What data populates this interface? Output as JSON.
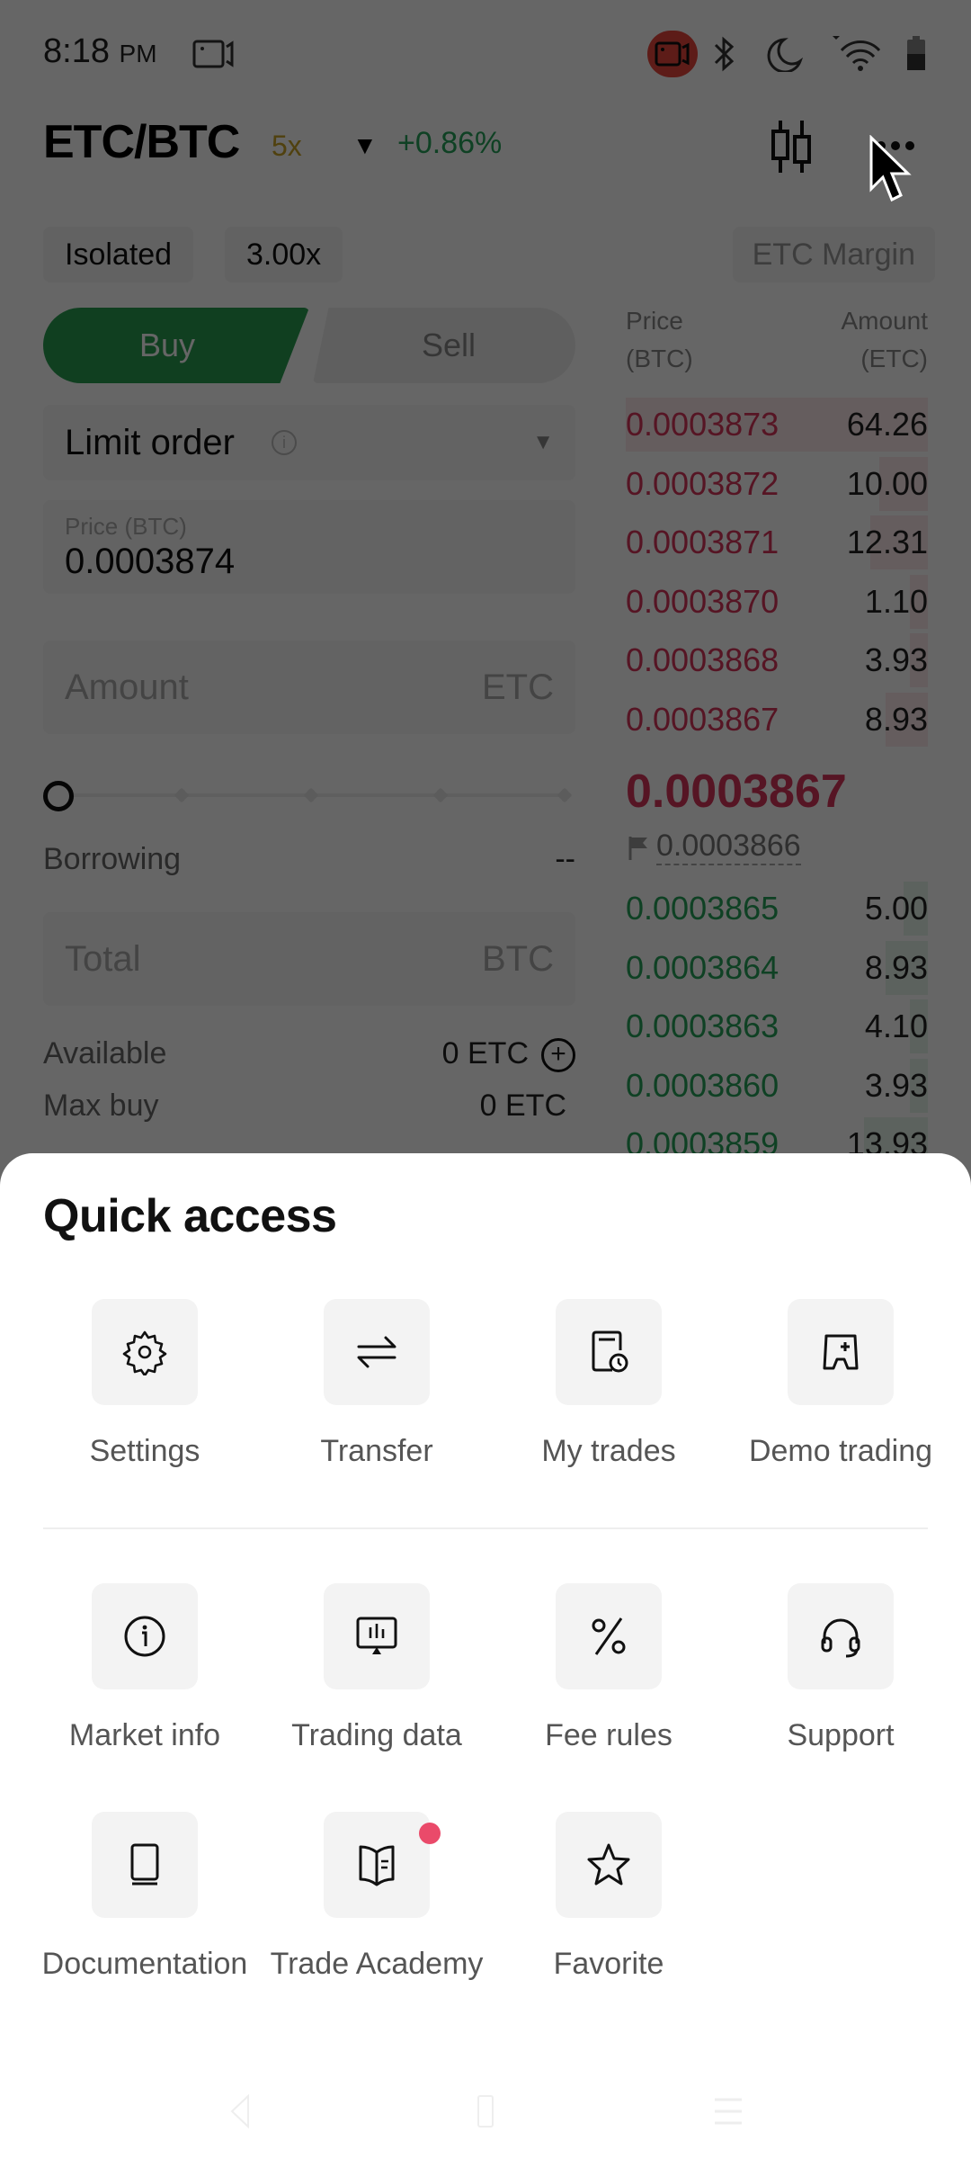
{
  "status_bar": {
    "time": "8:18",
    "ampm": "PM",
    "icons": [
      "screen-record-icon",
      "recording-active-icon",
      "bluetooth-icon",
      "do-not-disturb-icon",
      "wifi-icon",
      "battery-icon"
    ]
  },
  "header": {
    "pair": "ETC/BTC",
    "leverage_badge": "5x",
    "change": "+0.86%",
    "change_color": "#27a35a"
  },
  "margin": {
    "mode": "Isolated",
    "leverage": "3.00x",
    "margin_type": "ETC Margin"
  },
  "order_form": {
    "buy_label": "Buy",
    "sell_label": "Sell",
    "order_type": "Limit order",
    "price_label": "Price (BTC)",
    "price_value": "0.0003874",
    "amount_placeholder": "Amount",
    "amount_unit": "ETC",
    "slider_value_percent": 0,
    "borrowing_label": "Borrowing",
    "borrowing_value": "--",
    "total_placeholder": "Total",
    "total_unit": "BTC",
    "available_label": "Available",
    "available_value": "0 ETC",
    "max_buy_label": "Max buy",
    "max_buy_value": "0 ETC"
  },
  "order_book": {
    "price_header_1": "Price",
    "price_header_2": "(BTC)",
    "amount_header_1": "Amount",
    "amount_header_2": "(ETC)",
    "asks": [
      {
        "price": "0.0003873",
        "amount": "64.26",
        "depth": 1.0
      },
      {
        "price": "0.0003872",
        "amount": "10.00",
        "depth": 0.16
      },
      {
        "price": "0.0003871",
        "amount": "12.31",
        "depth": 0.19
      },
      {
        "price": "0.0003870",
        "amount": "1.10",
        "depth": 0.06
      },
      {
        "price": "0.0003868",
        "amount": "3.93",
        "depth": 0.06
      },
      {
        "price": "0.0003867",
        "amount": "8.93",
        "depth": 0.14
      }
    ],
    "last_price": "0.0003867",
    "mark_price": "0.0003866",
    "bids": [
      {
        "price": "0.0003865",
        "amount": "5.00",
        "depth": 0.08
      },
      {
        "price": "0.0003864",
        "amount": "8.93",
        "depth": 0.14
      },
      {
        "price": "0.0003863",
        "amount": "4.10",
        "depth": 0.06
      },
      {
        "price": "0.0003860",
        "amount": "3.93",
        "depth": 0.06
      },
      {
        "price": "0.0003859",
        "amount": "13.93",
        "depth": 0.21
      }
    ]
  },
  "quick_access": {
    "title": "Quick access",
    "items": [
      {
        "label": "Settings",
        "icon": "gear-icon"
      },
      {
        "label": "Transfer",
        "icon": "transfer-arrows-icon"
      },
      {
        "label": "My trades",
        "icon": "trade-history-icon"
      },
      {
        "label": "Demo trading",
        "icon": "demo-trading-icon"
      },
      {
        "label": "Market info",
        "icon": "info-icon"
      },
      {
        "label": "Trading data",
        "icon": "chart-monitor-icon"
      },
      {
        "label": "Fee rules",
        "icon": "percent-icon"
      },
      {
        "label": "Support",
        "icon": "headset-icon"
      },
      {
        "label": "Documentation",
        "icon": "book-icon"
      },
      {
        "label": "Trade Academy",
        "icon": "open-book-icon",
        "has_notification_dot": true
      },
      {
        "label": "Favorite",
        "icon": "star-icon"
      }
    ]
  },
  "colors": {
    "buy": "#2a9d52",
    "sell_text": "#d6365a",
    "badge_dot": "#ea4a6a"
  }
}
